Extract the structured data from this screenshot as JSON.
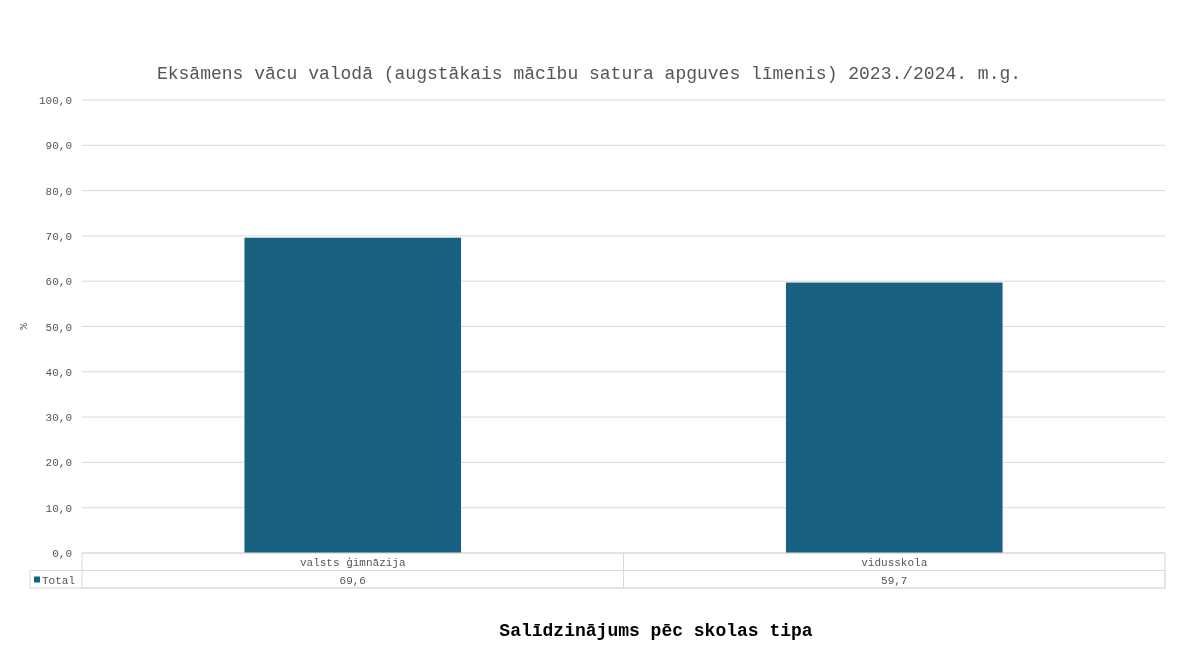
{
  "chart_data": {
    "type": "bar",
    "grid": true,
    "title": "Eksāmens vācu valodā (augstākais mācību satura apguves līmenis) 2023./2024. m.g.",
    "xlabel": "Salīdzinājums pēc skolas tipa",
    "ylabel": "%",
    "categories": [
      "valsts ģimnāzija",
      "vidusskola"
    ],
    "series": [
      {
        "name": "Total",
        "color": "#17607f",
        "values": [
          69.6,
          59.7
        ]
      }
    ],
    "ylim": [
      0,
      100
    ],
    "yticks": [
      {
        "value": 0,
        "label": "0,0"
      },
      {
        "value": 10,
        "label": "10,0"
      },
      {
        "value": 20,
        "label": "20,0"
      },
      {
        "value": 30,
        "label": "30,0"
      },
      {
        "value": 40,
        "label": "40,0"
      },
      {
        "value": 50,
        "label": "50,0"
      },
      {
        "value": 60,
        "label": "60,0"
      },
      {
        "value": 70,
        "label": "70,0"
      },
      {
        "value": 80,
        "label": "80,0"
      },
      {
        "value": 90,
        "label": "90,0"
      },
      {
        "value": 100,
        "label": "100,0"
      }
    ],
    "value_labels": [
      "69,6",
      "59,7"
    ]
  }
}
